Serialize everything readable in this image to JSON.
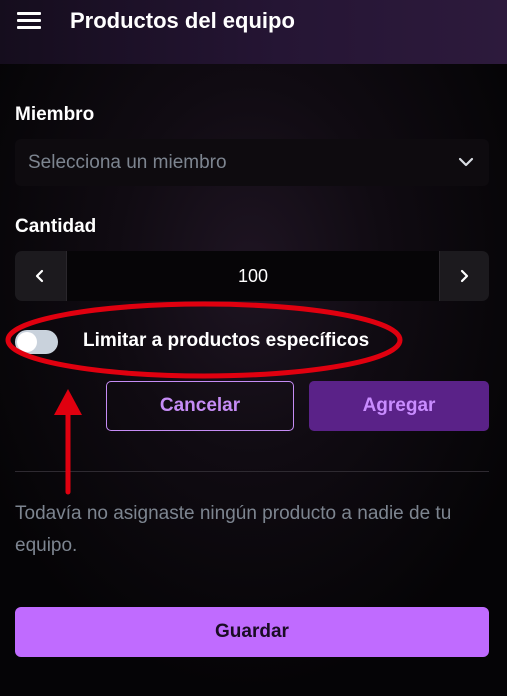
{
  "header": {
    "title": "Productos del equipo",
    "menu_icon": "hamburger-menu-icon"
  },
  "form": {
    "member_label": "Miembro",
    "member_select": {
      "placeholder": "Selecciona un miembro",
      "icon": "chevron-down-icon"
    },
    "quantity_label": "Cantidad",
    "quantity": {
      "value": "100",
      "decrement_icon": "chevron-left-icon",
      "increment_icon": "chevron-right-icon"
    },
    "limit_toggle": {
      "label": "Limitar a productos específicos",
      "checked": false
    },
    "cancel_label": "Cancelar",
    "add_label": "Agregar"
  },
  "empty_state": {
    "message": "Todavía no asignaste ningún producto a nadie de tu equipo."
  },
  "footer": {
    "save_label": "Guardar"
  },
  "colors": {
    "accent": "#c06bff",
    "add_button": "#5a2288",
    "annotation": "#e0000f"
  }
}
